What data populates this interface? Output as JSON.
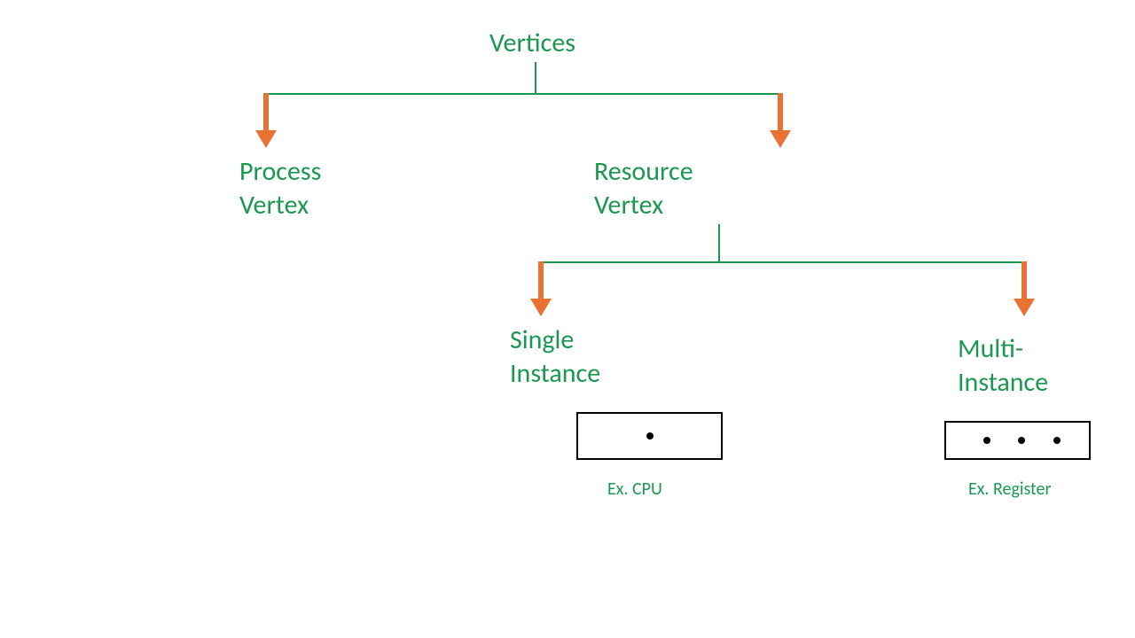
{
  "root": {
    "label": "Vertices"
  },
  "level1": {
    "left": {
      "line1": "Process",
      "line2": "Vertex"
    },
    "right": {
      "line1": "Resource",
      "line2": "Vertex"
    }
  },
  "level2": {
    "left": {
      "line1": "Single",
      "line2": "Instance",
      "example": "Ex. CPU"
    },
    "right": {
      "line1": "Multi-",
      "line2": "Instance",
      "example": "Ex. Register"
    }
  },
  "colors": {
    "text": "#1A9850",
    "line": "#1A9850",
    "arrow": "#E97132"
  }
}
